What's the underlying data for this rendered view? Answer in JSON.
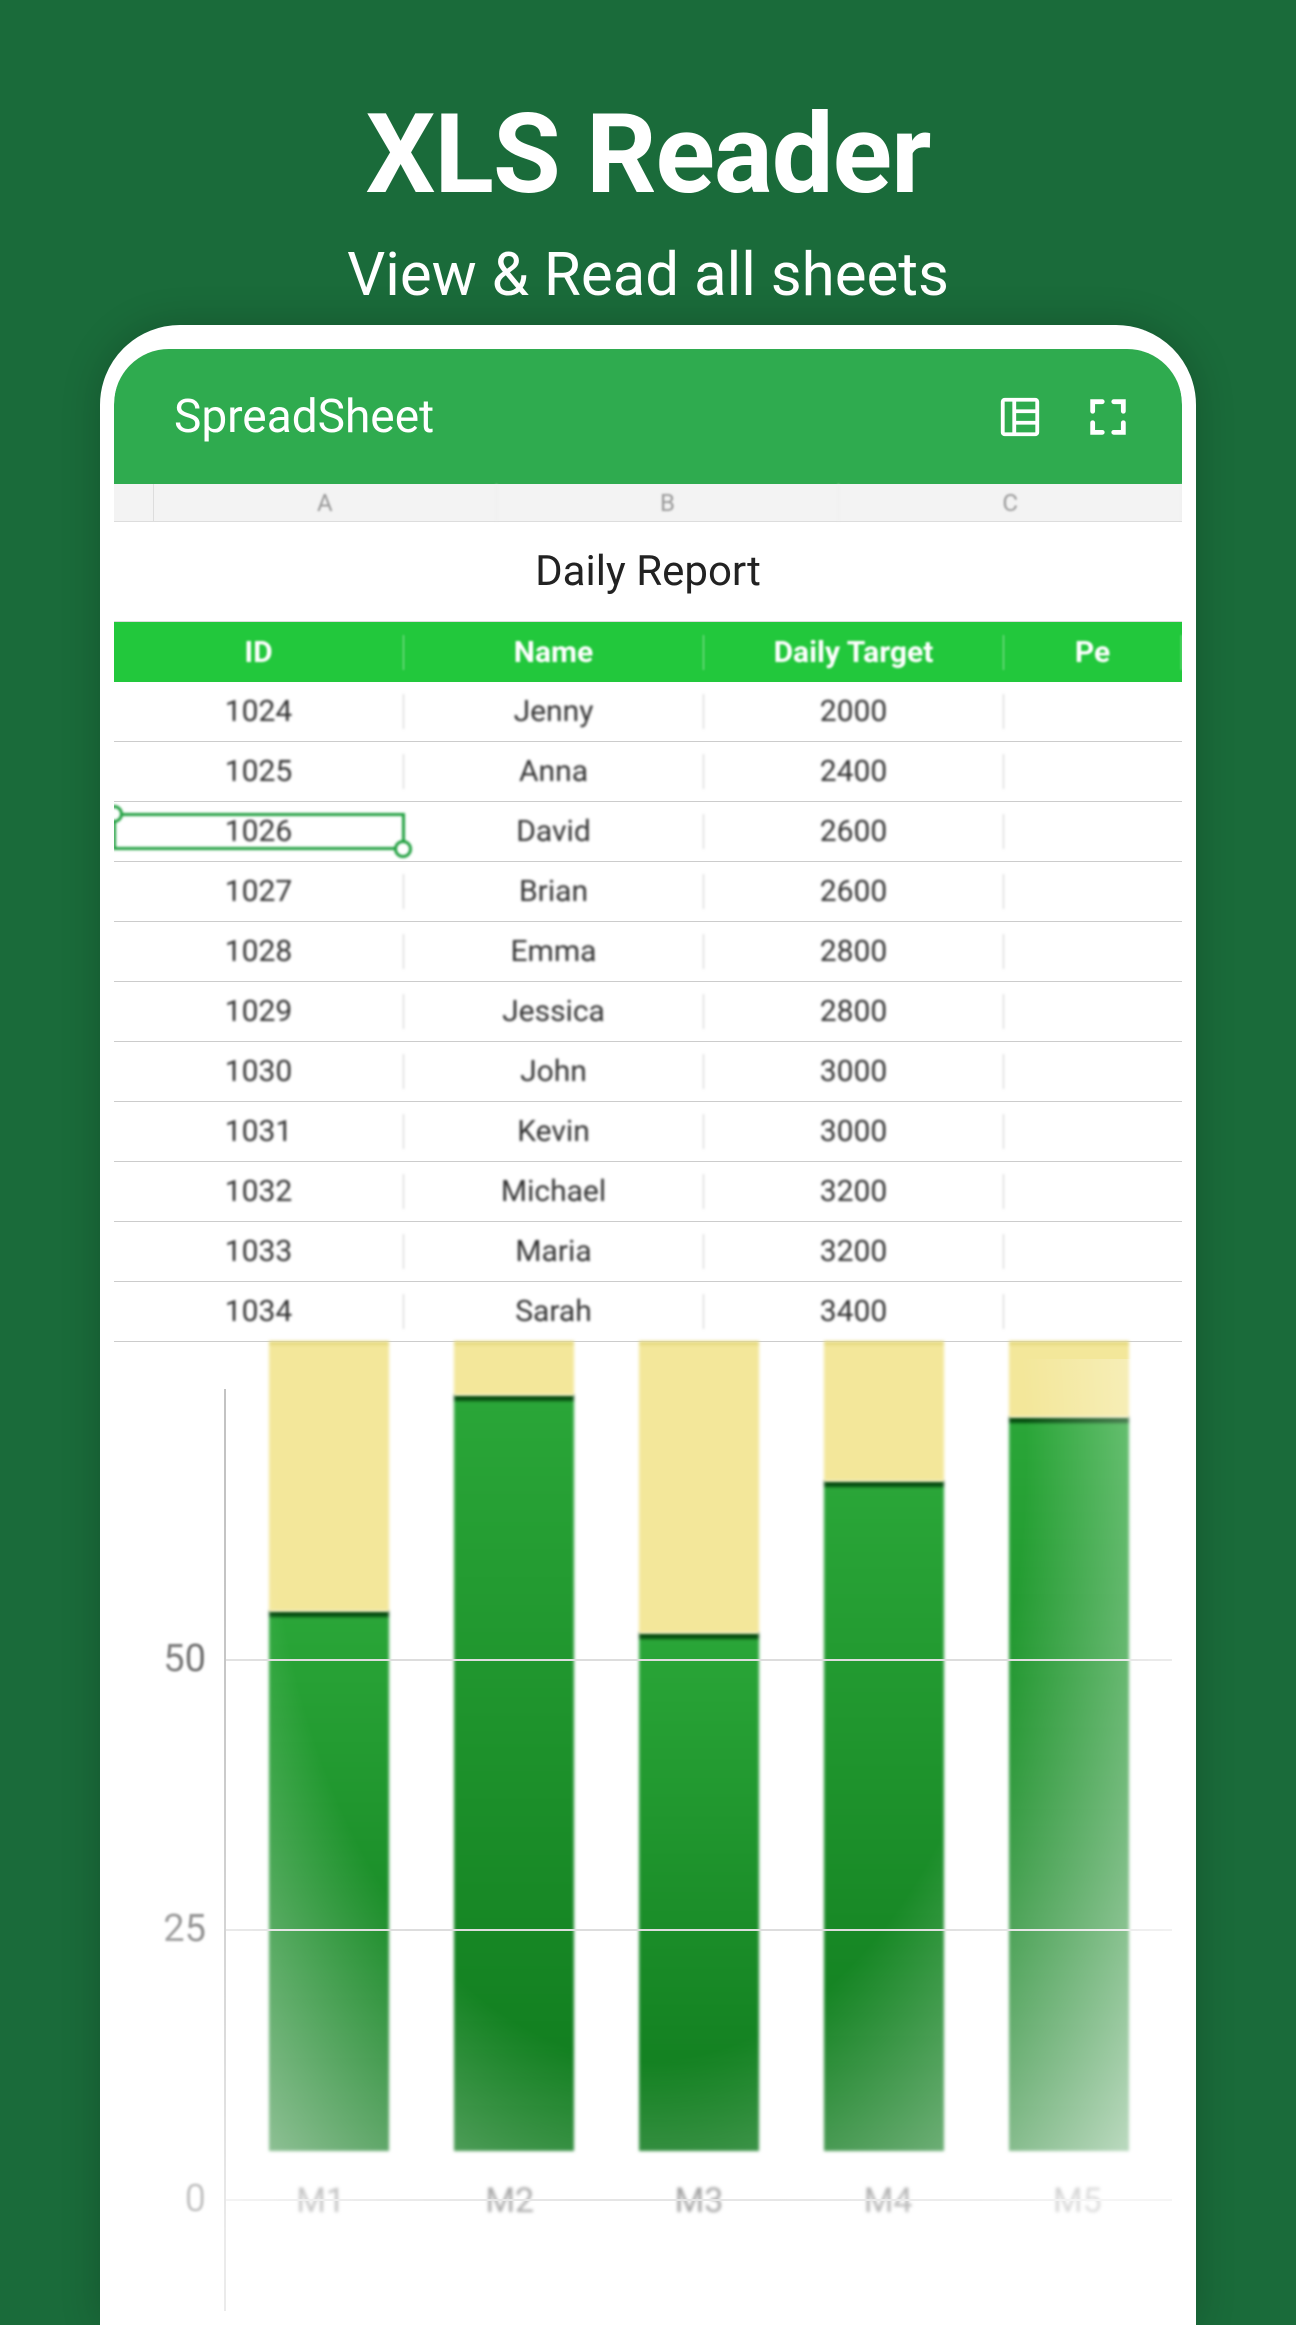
{
  "hero": {
    "title": "XLS Reader",
    "subtitle": "View & Read all sheets"
  },
  "appbar": {
    "title": "SpreadSheet"
  },
  "columns_header": [
    "A",
    "B",
    "C"
  ],
  "sheet_title": "Daily Report",
  "table": {
    "headers": [
      "ID",
      "Name",
      "Daily Target",
      "Pe"
    ],
    "selected_row_index": 2,
    "rows": [
      {
        "id": "1024",
        "name": "Jenny",
        "target": "2000"
      },
      {
        "id": "1025",
        "name": "Anna",
        "target": "2400"
      },
      {
        "id": "1026",
        "name": "David",
        "target": "2600"
      },
      {
        "id": "1027",
        "name": "Brian",
        "target": "2600"
      },
      {
        "id": "1028",
        "name": "Emma",
        "target": "2800"
      },
      {
        "id": "1029",
        "name": "Jessica",
        "target": "2800"
      },
      {
        "id": "1030",
        "name": "John",
        "target": "3000"
      },
      {
        "id": "1031",
        "name": "Kevin",
        "target": "3000"
      },
      {
        "id": "1032",
        "name": "Michael",
        "target": "3200"
      },
      {
        "id": "1033",
        "name": "Maria",
        "target": "3200"
      },
      {
        "id": "1034",
        "name": "Sarah",
        "target": "3400"
      }
    ]
  },
  "chart_data": {
    "type": "bar",
    "categories": [
      "M1",
      "M2",
      "M3",
      "M4",
      "M5"
    ],
    "y_ticks": [
      0,
      25,
      50
    ],
    "ylim": [
      0,
      75
    ],
    "series": [
      {
        "name": "green",
        "color": "#1b8f28",
        "values": [
          50,
          70,
          48,
          62,
          68
        ]
      },
      {
        "name": "yellow",
        "color": "#f3e79a",
        "values": [
          25,
          5,
          27,
          13,
          7
        ]
      }
    ]
  }
}
